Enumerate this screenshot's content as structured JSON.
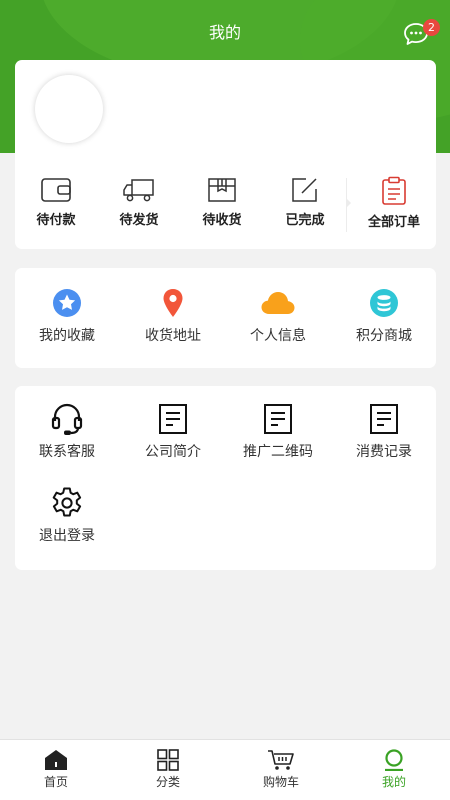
{
  "header": {
    "title": "我的",
    "message_badge": "2",
    "bg_color": "#44a227"
  },
  "orders": [
    {
      "label": "待付款",
      "icon": "wallet-icon"
    },
    {
      "label": "待发货",
      "icon": "truck-icon"
    },
    {
      "label": "待收货",
      "icon": "box-icon"
    },
    {
      "label": "已完成",
      "icon": "edit-icon"
    },
    {
      "label": "全部订单",
      "icon": "clipboard-icon"
    }
  ],
  "services": [
    {
      "label": "我的收藏",
      "icon": "star-icon"
    },
    {
      "label": "收货地址",
      "icon": "location-pin-icon"
    },
    {
      "label": "个人信息",
      "icon": "cloud-icon"
    },
    {
      "label": "积分商城",
      "icon": "database-icon"
    }
  ],
  "tools": [
    {
      "label": "联系客服",
      "icon": "headset-icon"
    },
    {
      "label": "公司简介",
      "icon": "document-icon"
    },
    {
      "label": "推广二维码",
      "icon": "document-icon"
    },
    {
      "label": "消费记录",
      "icon": "document-icon"
    },
    {
      "label": "退出登录",
      "icon": "gear-icon"
    }
  ],
  "tabbar": [
    {
      "label": "首页",
      "icon": "home-icon"
    },
    {
      "label": "分类",
      "icon": "grid-icon"
    },
    {
      "label": "购物车",
      "icon": "cart-icon"
    },
    {
      "label": "我的",
      "icon": "user-icon",
      "active": true
    }
  ],
  "colors": {
    "accent": "#3aa224",
    "badge": "#e8483f"
  }
}
